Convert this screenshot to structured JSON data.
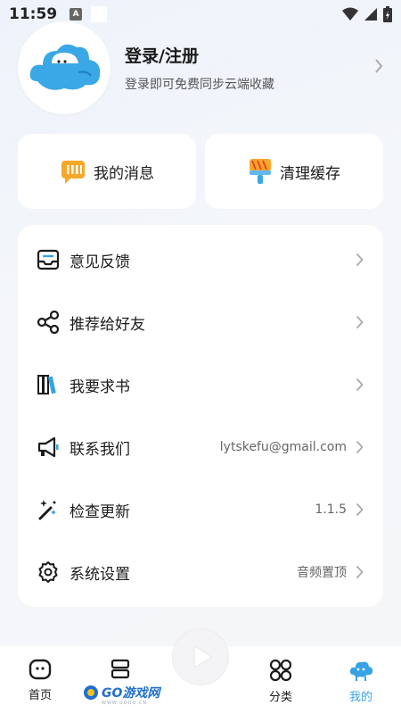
{
  "status_bar": {
    "time": "11:59",
    "notification_letter": "A"
  },
  "profile": {
    "title": "登录/注册",
    "subtitle": "登录即可免费同步云端收藏"
  },
  "quick_actions": [
    {
      "label": "我的消息",
      "icon": "message-icon"
    },
    {
      "label": "清理缓存",
      "icon": "broom-icon"
    }
  ],
  "menu": {
    "items": [
      {
        "label": "意见反馈",
        "value": "",
        "icon": "inbox-icon"
      },
      {
        "label": "推荐给好友",
        "value": "",
        "icon": "share-icon"
      },
      {
        "label": "我要求书",
        "value": "",
        "icon": "books-icon"
      },
      {
        "label": "联系我们",
        "value": "lytskefu@gmail.com",
        "icon": "megaphone-icon"
      },
      {
        "label": "检查更新",
        "value": "1.1.5",
        "icon": "magic-wand-icon"
      },
      {
        "label": "系统设置",
        "value": "音频置顶",
        "icon": "gear-icon"
      }
    ]
  },
  "bottom_nav": {
    "items": [
      {
        "label": "首页",
        "icon": "home-icon",
        "active": false
      },
      {
        "label": "",
        "icon": "bookshelf-icon",
        "active": false
      },
      {
        "label": "",
        "icon": "play-icon",
        "active": false
      },
      {
        "label": "分类",
        "icon": "category-icon",
        "active": false
      },
      {
        "label": "我的",
        "icon": "profile-icon",
        "active": true
      }
    ]
  },
  "watermark": {
    "text": "GO游戏网",
    "sub": "WWW.GOGO.CN"
  },
  "colors": {
    "accent": "#38a3e4",
    "avatar_blue": "#3aa7e6",
    "background": "#f4f6fa"
  }
}
